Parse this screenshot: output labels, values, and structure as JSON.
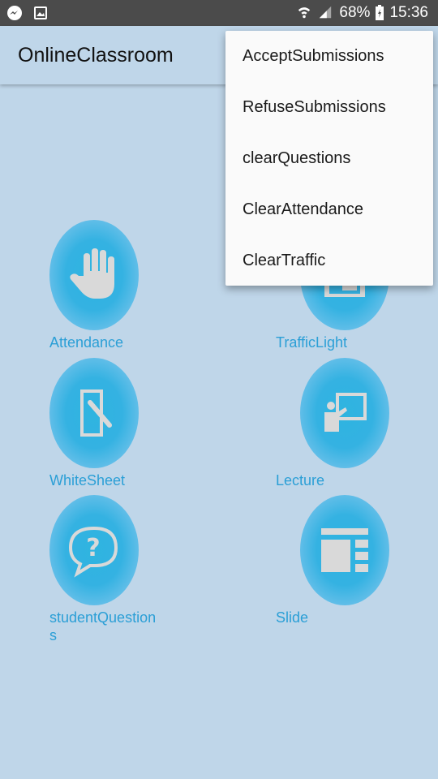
{
  "status_bar": {
    "battery": "68%",
    "time": "15:36",
    "icons": [
      "messenger-icon",
      "image-icon",
      "wifi-icon",
      "signal-icon",
      "battery-icon"
    ]
  },
  "app_bar": {
    "title": "OnlineClassroom"
  },
  "tiles": [
    {
      "label": "Attendance",
      "icon": "hand-icon"
    },
    {
      "label": "TrafficLight",
      "icon": "traffic-light-icon"
    },
    {
      "label": "WhiteSheet",
      "icon": "white-sheet-icon"
    },
    {
      "label": "Lecture",
      "icon": "lecture-icon"
    },
    {
      "label": "studentQuestions",
      "icon": "question-bubble-icon"
    },
    {
      "label": "Slide",
      "icon": "slide-icon"
    }
  ],
  "menu": {
    "items": [
      {
        "label": "AcceptSubmissions"
      },
      {
        "label": "RefuseSubmissions"
      },
      {
        "label": "clearQuestions"
      },
      {
        "label": "ClearAttendance"
      },
      {
        "label": "ClearTraffic"
      }
    ]
  },
  "colors": {
    "background": "#bfd6e9",
    "status_bar": "#4b4b4b",
    "accent": "#2b9fd6",
    "circle": "#34b2e2",
    "icon_fill": "#d9d9d9",
    "menu_bg": "#fafafa"
  }
}
